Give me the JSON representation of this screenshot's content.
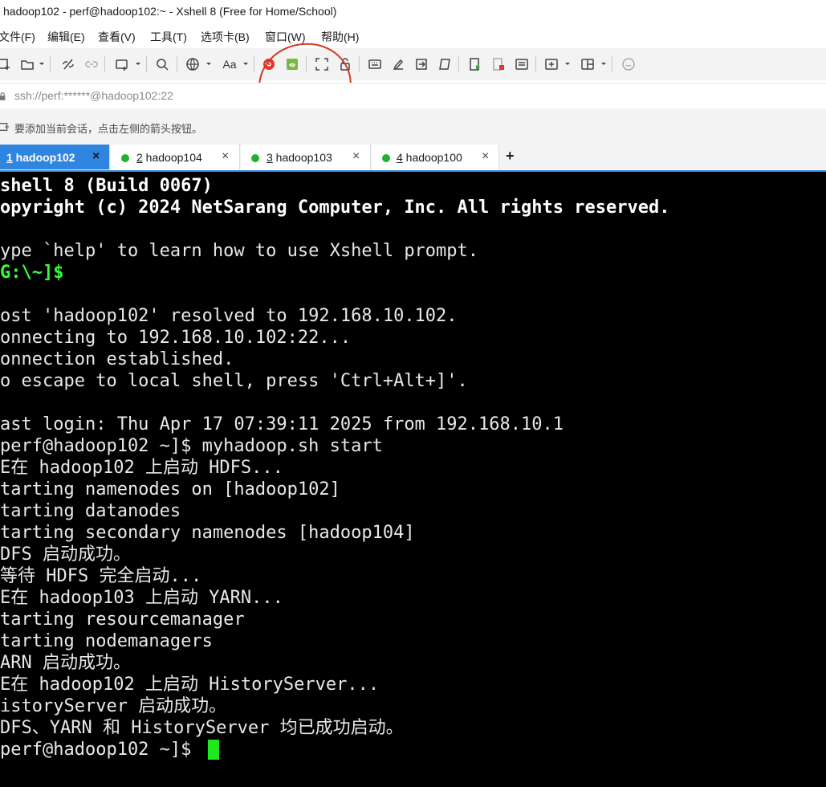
{
  "window": {
    "title": "hadoop102 - perf@hadoop102:~ - Xshell 8 (Free for Home/School)"
  },
  "menu": {
    "items": [
      "文件(F)",
      "编辑(E)",
      "查看(V)",
      "工具(T)",
      "选项卡(B)",
      "窗口(W)",
      "帮助(H)"
    ]
  },
  "toolbar": {
    "icons": [
      "new-session-icon",
      "open-folder-icon",
      "disconnect-icon",
      "reconnect-icon",
      "new-window-icon",
      "search-icon",
      "globe-icon",
      "font-icon",
      "xftp-icon",
      "xftp-green-icon",
      "fullscreen-icon",
      "lock-icon",
      "keyboard-icon",
      "compose-icon",
      "send-icon",
      "script-icon",
      "run-script-icon",
      "log-icon",
      "notes-icon",
      "add-panel-icon",
      "layout-icon",
      "chat-icon"
    ],
    "font_label": "Aa"
  },
  "address": {
    "value": "ssh://perf:******@hadoop102:22"
  },
  "hint": {
    "text": "要添加当前会话，点击左侧的箭头按钮。"
  },
  "tabs": [
    {
      "num": "1",
      "label": " hadoop102",
      "active": true
    },
    {
      "num": "2",
      "label": " hadoop104",
      "active": false
    },
    {
      "num": "3",
      "label": " hadoop103",
      "active": false
    },
    {
      "num": "4",
      "label": " hadoop100",
      "active": false
    }
  ],
  "tab_close": "×",
  "new_tab": "+",
  "terminal": {
    "lines": [
      {
        "text": "shell 8 (Build 0067)",
        "style": "bold"
      },
      {
        "text": "opyright (c) 2024 NetSarang Computer, Inc. All rights reserved.",
        "style": "bold"
      },
      {
        "text": "",
        "style": ""
      },
      {
        "text": "ype `help' to learn how to use Xshell prompt.",
        "style": ""
      },
      {
        "text": "G:\\~]$",
        "style": "green"
      },
      {
        "text": "",
        "style": ""
      },
      {
        "text": "ost 'hadoop102' resolved to 192.168.10.102.",
        "style": ""
      },
      {
        "text": "onnecting to 192.168.10.102:22...",
        "style": ""
      },
      {
        "text": "onnection established.",
        "style": ""
      },
      {
        "text": "o escape to local shell, press 'Ctrl+Alt+]'.",
        "style": ""
      },
      {
        "text": "",
        "style": ""
      },
      {
        "text": "ast login: Thu Apr 17 07:39:11 2025 from 192.168.10.1",
        "style": ""
      },
      {
        "text": "perf@hadoop102 ~]$ myhadoop.sh start",
        "style": ""
      },
      {
        "text": "E在 hadoop102 上启动 HDFS...",
        "style": ""
      },
      {
        "text": "tarting namenodes on [hadoop102]",
        "style": ""
      },
      {
        "text": "tarting datanodes",
        "style": ""
      },
      {
        "text": "tarting secondary namenodes [hadoop104]",
        "style": ""
      },
      {
        "text": "DFS 启动成功。",
        "style": ""
      },
      {
        "text": "等待 HDFS 完全启动...",
        "style": ""
      },
      {
        "text": "E在 hadoop103 上启动 YARN...",
        "style": ""
      },
      {
        "text": "tarting resourcemanager",
        "style": ""
      },
      {
        "text": "tarting nodemanagers",
        "style": ""
      },
      {
        "text": "ARN 启动成功。",
        "style": ""
      },
      {
        "text": "E在 hadoop102 上启动 HistoryServer...",
        "style": ""
      },
      {
        "text": "istoryServer 启动成功。",
        "style": ""
      },
      {
        "text": "DFS、YARN 和 HistoryServer 均已成功启动。",
        "style": ""
      },
      {
        "text": "perf@hadoop102 ~]$ ",
        "style": ""
      }
    ]
  },
  "colors": {
    "accent": "#2f86e0",
    "prompt_green": "#33ff33",
    "cursor": "#1ee81e",
    "annotation": "#d03a22"
  }
}
